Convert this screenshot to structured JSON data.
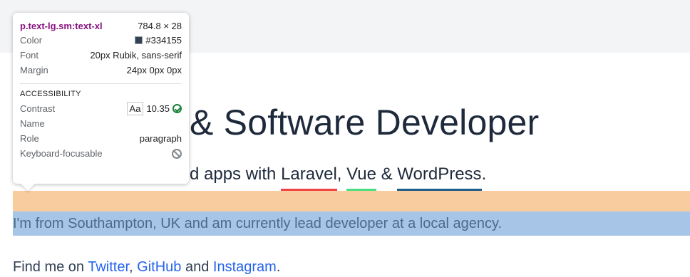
{
  "page": {
    "headline": "& Software Developer",
    "subline_prefix": "d apps with ",
    "tech1": "Laravel",
    "sep1": ", ",
    "tech2": "Vue",
    "sep2": " & ",
    "tech3": "WordPress",
    "subline_suffix": ".",
    "paragraph": "I'm from Southampton, UK and am currently lead developer at a local agency.",
    "find_prefix": "Find me on ",
    "twitter": "Twitter",
    "sep_a": ", ",
    "github": "GitHub",
    "sep_b": " and ",
    "instagram": "Instagram",
    "find_suffix": "."
  },
  "colors": {
    "laravel": "#ef4444",
    "vue": "#4ade80",
    "wordpress": "#1e5f8c",
    "link": "#2563eb"
  },
  "tooltip": {
    "selector": "p.text-lg.sm:text-xl",
    "size": "784.8 × 28",
    "color_label": "Color",
    "color_value": "#334155",
    "font_label": "Font",
    "font_value": "20px Rubik, sans-serif",
    "margin_label": "Margin",
    "margin_value": "24px 0px 0px",
    "section_title": "ACCESSIBILITY",
    "contrast_label": "Contrast",
    "contrast_sample": "Aa",
    "contrast_value": "10.35",
    "name_label": "Name",
    "name_value": "",
    "role_label": "Role",
    "role_value": "paragraph",
    "focusable_label": "Keyboard-focusable",
    "icons": {
      "contrast_pass": "check-circle-icon",
      "focusable": "no-entry-icon"
    }
  }
}
